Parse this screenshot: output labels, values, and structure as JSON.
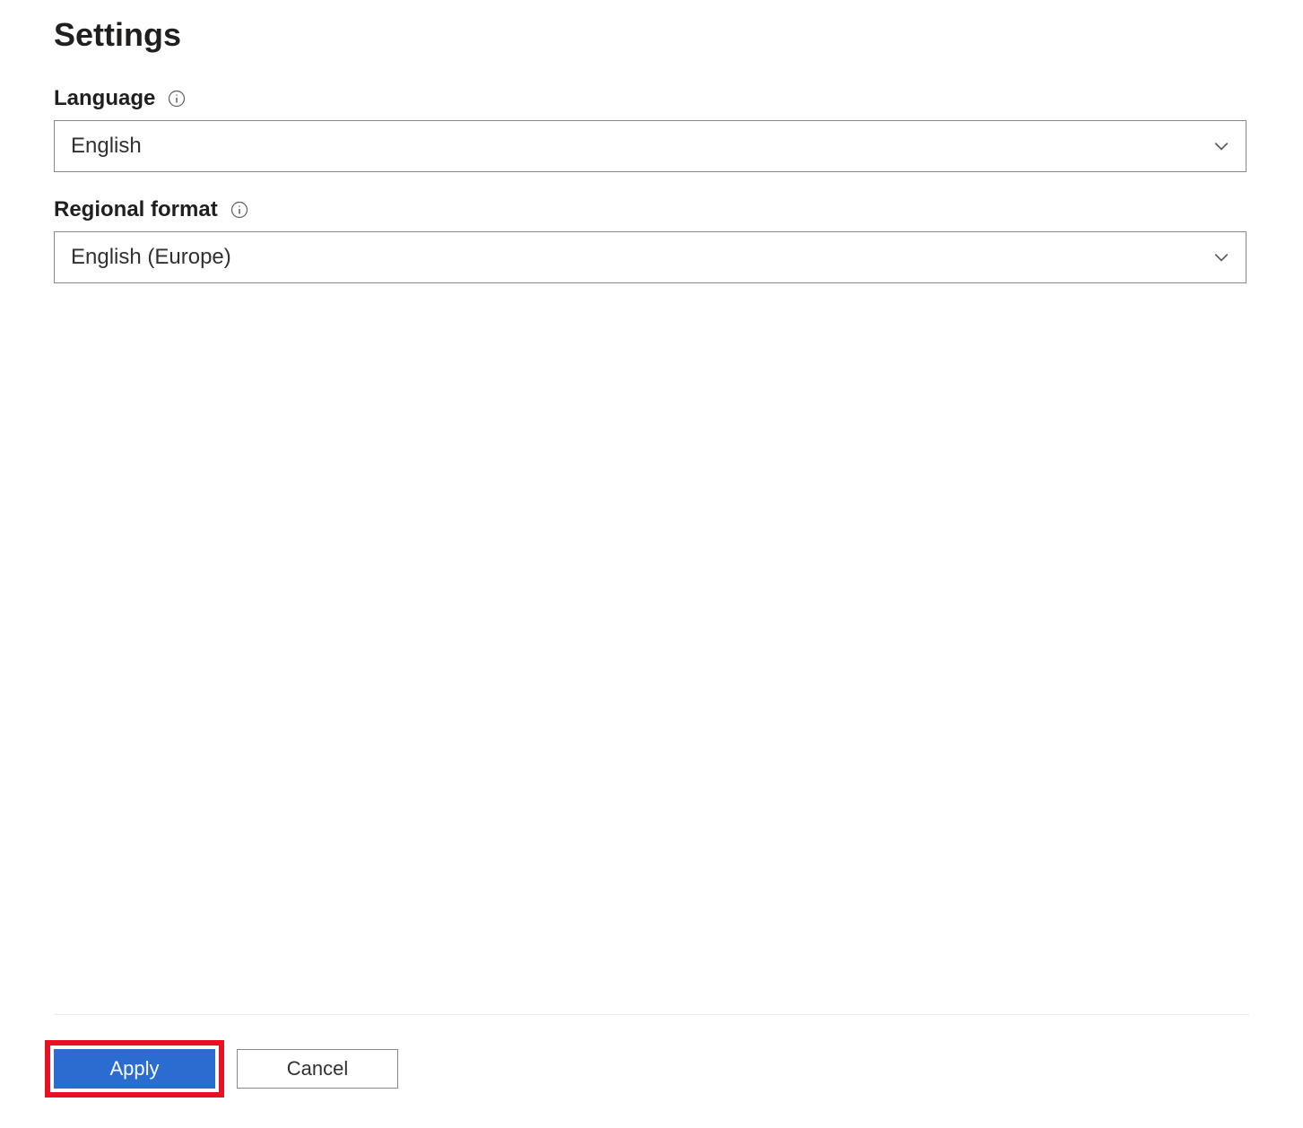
{
  "page": {
    "title": "Settings"
  },
  "fields": {
    "language": {
      "label": "Language",
      "value": "English"
    },
    "regional_format": {
      "label": "Regional format",
      "value": "English (Europe)"
    }
  },
  "footer": {
    "apply_label": "Apply",
    "cancel_label": "Cancel"
  }
}
